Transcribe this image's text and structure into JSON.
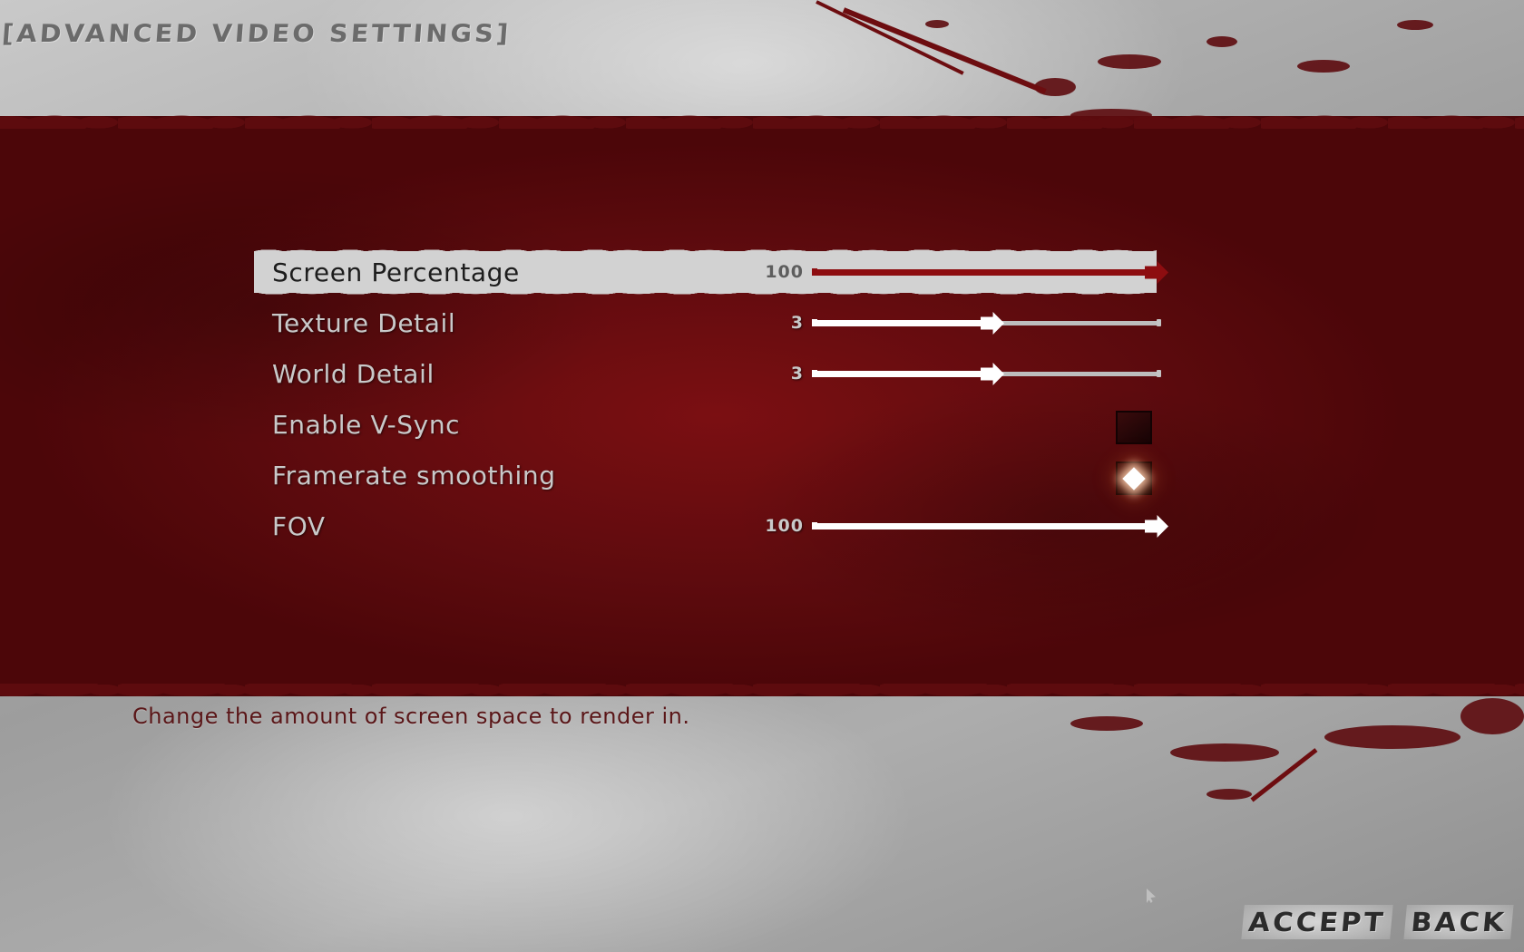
{
  "header": {
    "title": "[ADVANCED VIDEO SETTINGS]"
  },
  "settings": [
    {
      "label": "Screen Percentage",
      "control": "slider",
      "value": "100",
      "fill_percent": 100,
      "selected": true
    },
    {
      "label": "Texture Detail",
      "control": "slider",
      "value": "3",
      "fill_percent": 50,
      "selected": false
    },
    {
      "label": "World Detail",
      "control": "slider",
      "value": "3",
      "fill_percent": 50,
      "selected": false
    },
    {
      "label": "Enable V-Sync",
      "control": "checkbox",
      "checked": false,
      "selected": false
    },
    {
      "label": "Framerate smoothing",
      "control": "checkbox",
      "checked": true,
      "selected": false
    },
    {
      "label": "FOV",
      "control": "slider",
      "value": "100",
      "fill_percent": 100,
      "selected": false
    }
  ],
  "description": "Change the amount of screen space to render in.",
  "buttons": [
    {
      "label": "ACCEPT",
      "name": "accept-button"
    },
    {
      "label": "BACK",
      "name": "back-button"
    }
  ],
  "colors": {
    "band_red": "#5d0b0e",
    "accent_red": "#8d0d10",
    "highlight_bar": "#d2d2d2",
    "label_text": "#c9c9c9",
    "selected_label_text": "#1d1d1d",
    "description_text": "#5a1618",
    "background_gray": "#a8a8a8"
  },
  "cursor": {
    "name": "mouse-pointer"
  }
}
